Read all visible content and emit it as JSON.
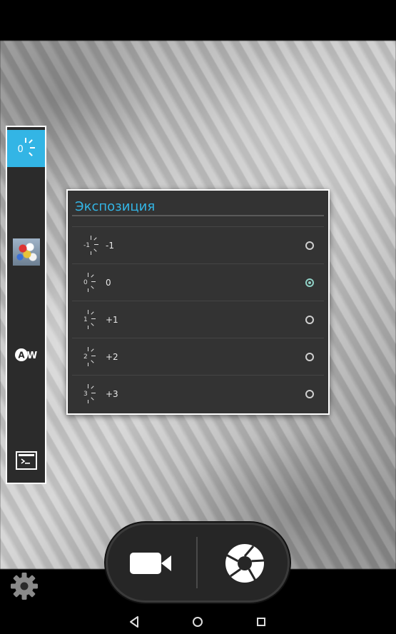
{
  "dialog": {
    "title": "Экспозиция",
    "options": [
      {
        "glyph": "-1",
        "label": "-1",
        "selected": false
      },
      {
        "glyph": "0",
        "label": "0",
        "selected": true
      },
      {
        "glyph": "1",
        "label": "+1",
        "selected": false
      },
      {
        "glyph": "2",
        "label": "+2",
        "selected": false
      },
      {
        "glyph": "3",
        "label": "+3",
        "selected": false
      }
    ]
  },
  "left_strip": {
    "exposure_value": "0",
    "white_balance_text": "AW",
    "items": [
      "exposure-icon",
      "scene-mode-thumbnail",
      "white-balance-auto-icon",
      "timer-icon"
    ]
  },
  "controls": {
    "video_icon": "video-camera-icon",
    "shutter_icon": "camera-shutter-icon",
    "settings_icon": "gear-icon"
  },
  "nav": {
    "back": "back-icon",
    "home": "home-icon",
    "recent": "recent-apps-icon"
  },
  "colors": {
    "accent": "#33b5e5",
    "radio_checked": "#8fd0c5",
    "dialog_bg": "#333333"
  }
}
